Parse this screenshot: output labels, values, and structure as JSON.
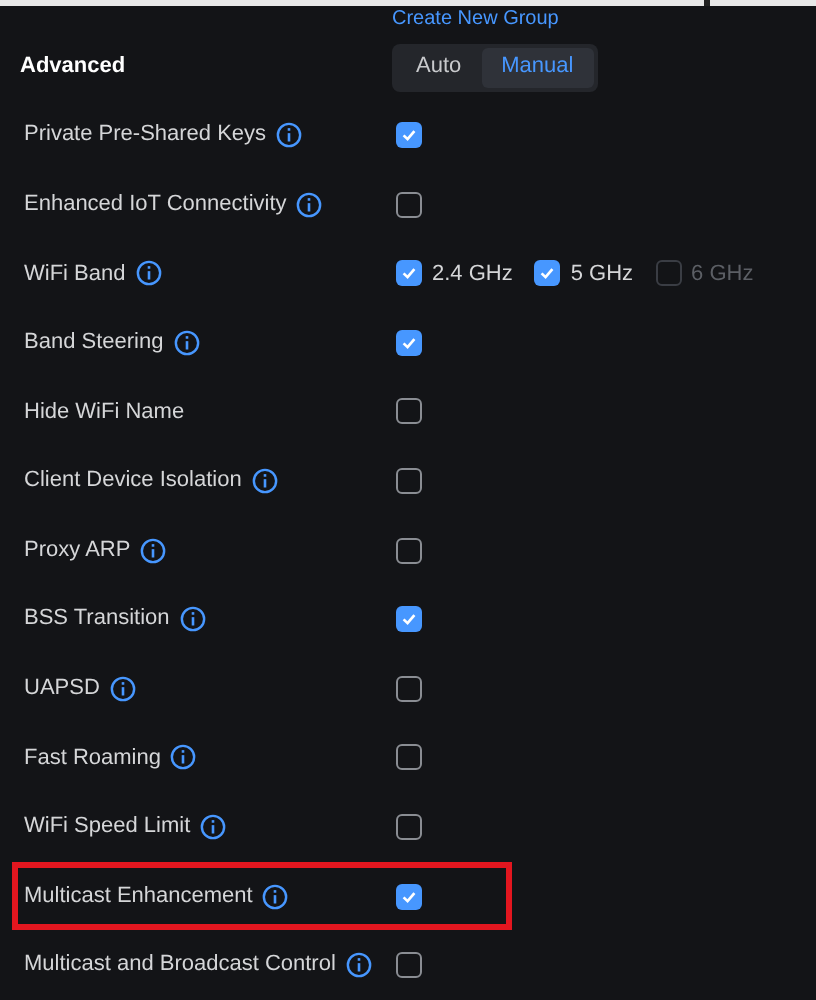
{
  "top_link": "Create New Group",
  "section": {
    "title": "Advanced",
    "modes": [
      {
        "label": "Auto",
        "selected": false
      },
      {
        "label": "Manual",
        "selected": true
      }
    ]
  },
  "rows": [
    {
      "kind": "checkbox",
      "label": "Private Pre-Shared Keys",
      "info": true,
      "checked": true,
      "highlighted": false
    },
    {
      "kind": "checkbox",
      "label": "Enhanced IoT Connectivity",
      "info": true,
      "checked": false,
      "highlighted": false
    },
    {
      "kind": "bands",
      "label": "WiFi Band",
      "info": true,
      "highlighted": false,
      "bands": [
        {
          "label": "2.4 GHz",
          "checked": true,
          "disabled": false
        },
        {
          "label": "5 GHz",
          "checked": true,
          "disabled": false
        },
        {
          "label": "6 GHz",
          "checked": false,
          "disabled": true
        }
      ]
    },
    {
      "kind": "checkbox",
      "label": "Band Steering",
      "info": true,
      "checked": true,
      "highlighted": false
    },
    {
      "kind": "checkbox",
      "label": "Hide WiFi Name",
      "info": false,
      "checked": false,
      "highlighted": false
    },
    {
      "kind": "checkbox",
      "label": "Client Device Isolation",
      "info": true,
      "checked": false,
      "highlighted": false
    },
    {
      "kind": "checkbox",
      "label": "Proxy ARP",
      "info": true,
      "checked": false,
      "highlighted": false
    },
    {
      "kind": "checkbox",
      "label": "BSS Transition",
      "info": true,
      "checked": true,
      "highlighted": false
    },
    {
      "kind": "checkbox",
      "label": "UAPSD",
      "info": true,
      "checked": false,
      "highlighted": false
    },
    {
      "kind": "checkbox",
      "label": "Fast Roaming",
      "info": true,
      "checked": false,
      "highlighted": false
    },
    {
      "kind": "checkbox",
      "label": "WiFi Speed Limit",
      "info": true,
      "checked": false,
      "highlighted": false
    },
    {
      "kind": "checkbox",
      "label": "Multicast Enhancement",
      "info": true,
      "checked": true,
      "highlighted": true
    },
    {
      "kind": "checkbox",
      "label": "Multicast and Broadcast Control",
      "info": true,
      "checked": false,
      "highlighted": false
    }
  ]
}
